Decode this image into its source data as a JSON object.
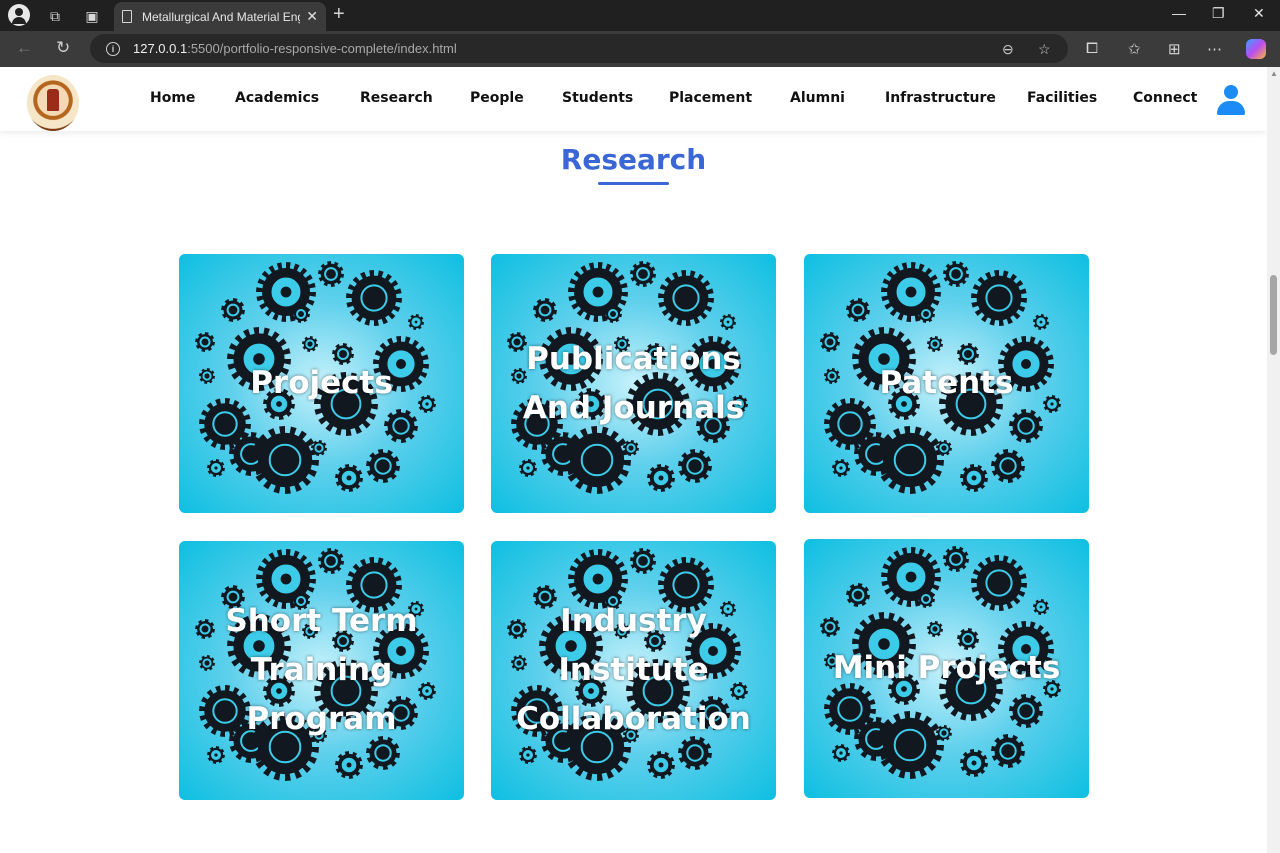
{
  "browser": {
    "tab_title": "Metallurgical And Material Engine",
    "url_host": "127.0.0.1",
    "url_path": ":5500/portfolio-responsive-complete/index.html"
  },
  "header": {
    "nav": [
      {
        "label": "Home"
      },
      {
        "label": "Academics"
      },
      {
        "label": "Research"
      },
      {
        "label": "People"
      },
      {
        "label": "Students"
      },
      {
        "label": "Placement"
      },
      {
        "label": "Alumni"
      },
      {
        "label": "Infrastructure"
      },
      {
        "label": "Facilities"
      },
      {
        "label": "Connect"
      }
    ]
  },
  "section": {
    "title": "Research"
  },
  "cards": [
    {
      "label": "Projects"
    },
    {
      "label": "Publications And Journals"
    },
    {
      "label": "Patents"
    },
    {
      "label": "Short Term Training Program"
    },
    {
      "label": "Industry Institute Collaboration"
    },
    {
      "label": "Mini Projects"
    }
  ],
  "colors": {
    "accent": "#3b66d6",
    "card_bg": "#0ebfe1",
    "user_icon": "#1c8bf5"
  }
}
